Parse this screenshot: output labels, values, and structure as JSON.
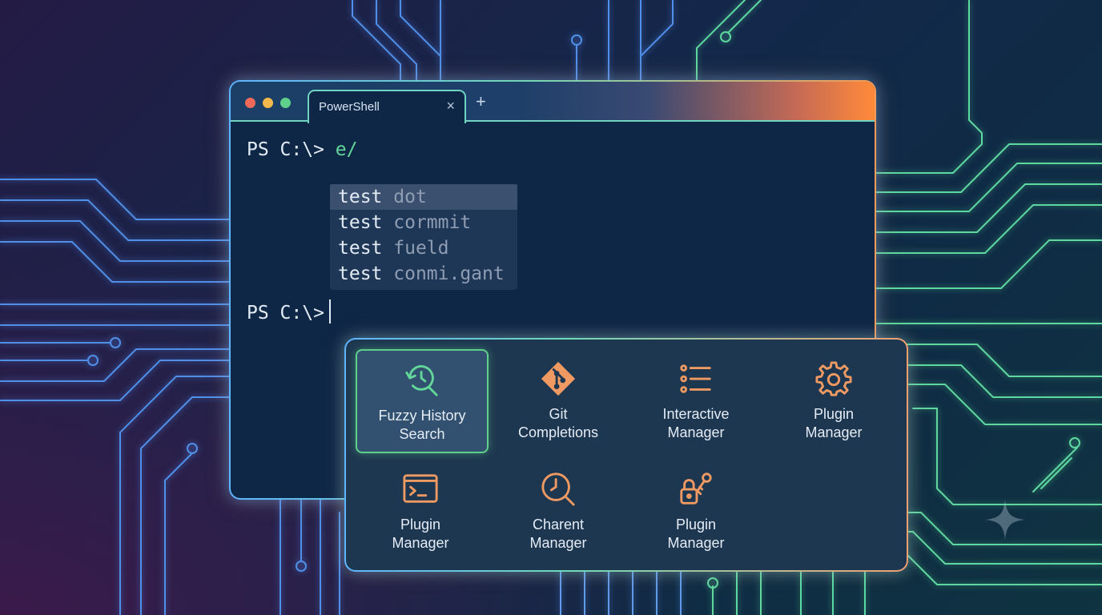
{
  "window": {
    "tab_title": "PowerShell",
    "tab_close": "×",
    "new_tab": "+"
  },
  "terminal": {
    "prompt": "PS C:\\>",
    "typed_command": "e/",
    "suggestions": [
      {
        "cmd": "test",
        "arg": "dot"
      },
      {
        "cmd": "test",
        "arg": "cormmit"
      },
      {
        "cmd": "test",
        "arg": "fueld"
      },
      {
        "cmd": "test",
        "arg": "conmi.gant"
      }
    ],
    "prompt2": "PS C:\\>"
  },
  "panel": {
    "items": [
      {
        "line1": "Fuzzy History",
        "line2": "Search",
        "icon": "history-search-icon",
        "color": "#63d79a"
      },
      {
        "line1": "Git",
        "line2": "Completions",
        "icon": "git-icon",
        "color": "#ef9a63"
      },
      {
        "line1": "Interactive",
        "line2": "Manager",
        "icon": "list-icon",
        "color": "#ef9a63"
      },
      {
        "line1": "Plugin",
        "line2": "Manager",
        "icon": "gear-icon",
        "color": "#ef9a63"
      },
      {
        "line1": "Plugin",
        "line2": "Manager",
        "icon": "terminal-icon",
        "color": "#ef9a63"
      },
      {
        "line1": "Charent",
        "line2": "Manager",
        "icon": "clock-search-icon",
        "color": "#ef9a63"
      },
      {
        "line1": "Plugin",
        "line2": "Manager",
        "icon": "lock-key-icon",
        "color": "#ef9a63"
      }
    ]
  },
  "colors": {
    "accent_green": "#63d79a",
    "accent_orange": "#ef9a63",
    "accent_blue": "#5fb4ff"
  }
}
